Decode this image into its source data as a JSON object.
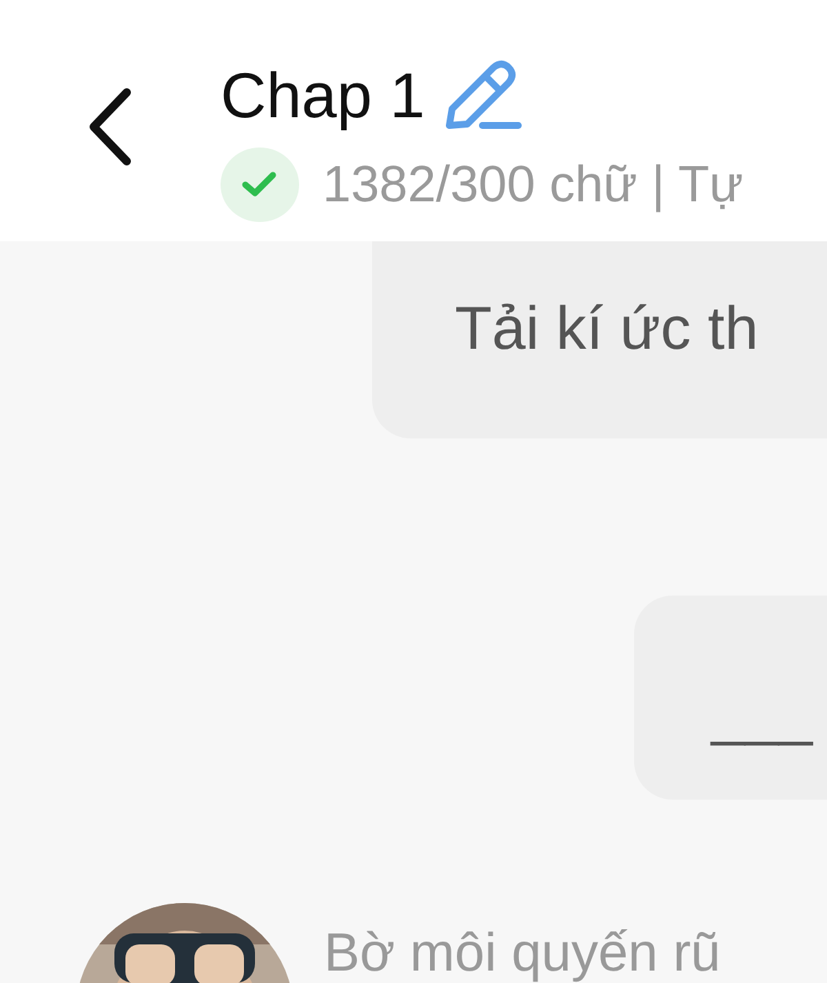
{
  "header": {
    "title": "Chap 1",
    "word_count": "1382/300 chữ | Tự"
  },
  "messages": [
    {
      "kind": "bubble",
      "text": "Tải kí ức th"
    },
    {
      "kind": "bubble",
      "text": "___"
    },
    {
      "kind": "comment",
      "text": "Bờ môi quyến rũ"
    }
  ]
}
